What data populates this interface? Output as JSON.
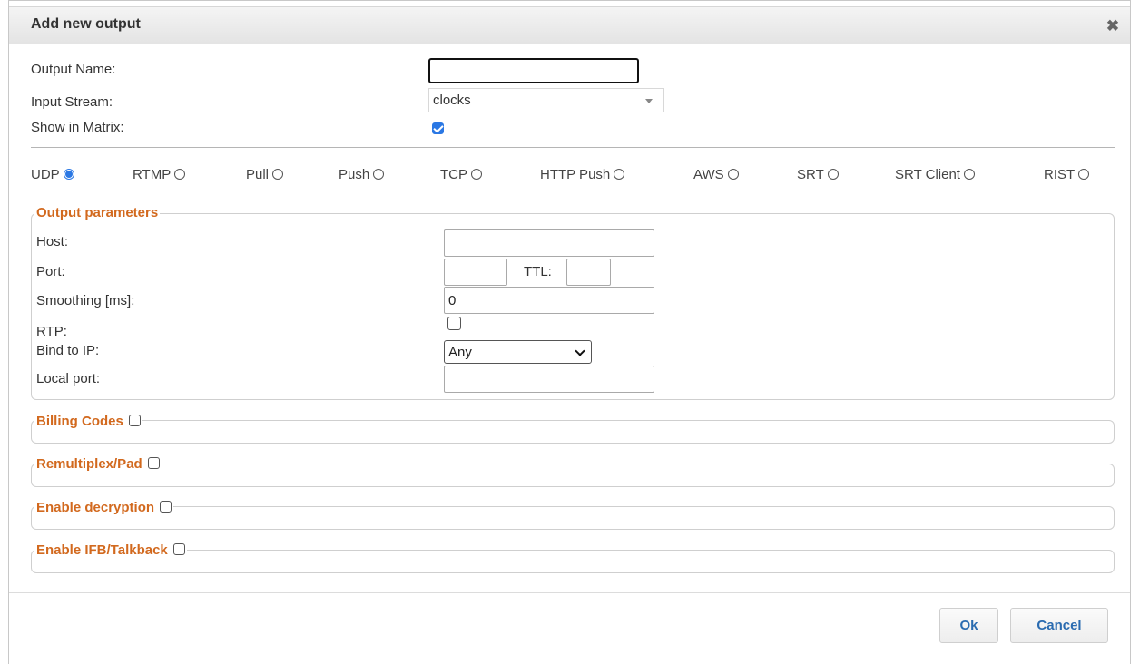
{
  "dialog": {
    "title": "Add new output"
  },
  "general": {
    "output_name_label": "Output Name:",
    "output_name_value": "",
    "input_stream_label": "Input Stream:",
    "input_stream_value": "clocks",
    "show_in_matrix_label": "Show in Matrix:",
    "show_in_matrix_checked": true
  },
  "protocols": [
    {
      "label": "UDP",
      "selected": true
    },
    {
      "label": "RTMP",
      "selected": false
    },
    {
      "label": "Pull",
      "selected": false
    },
    {
      "label": "Push",
      "selected": false
    },
    {
      "label": "TCP",
      "selected": false
    },
    {
      "label": "HTTP Push",
      "selected": false
    },
    {
      "label": "AWS",
      "selected": false
    },
    {
      "label": "SRT",
      "selected": false
    },
    {
      "label": "SRT Client",
      "selected": false
    },
    {
      "label": "RIST",
      "selected": false
    }
  ],
  "output_parameters": {
    "legend": "Output parameters",
    "host_label": "Host:",
    "host_value": "",
    "port_label": "Port:",
    "port_value": "",
    "ttl_label": "TTL:",
    "ttl_value": "",
    "smoothing_label": "Smoothing [ms]:",
    "smoothing_value": "0",
    "rtp_label": "RTP:",
    "rtp_checked": false,
    "bind_label": "Bind to IP:",
    "bind_value": "Any",
    "local_port_label": "Local port:",
    "local_port_value": ""
  },
  "sections": [
    {
      "label": "Billing Codes",
      "checked": false
    },
    {
      "label": "Remultiplex/Pad",
      "checked": false
    },
    {
      "label": "Enable decryption",
      "checked": false
    },
    {
      "label": "Enable IFB/Talkback",
      "checked": false
    }
  ],
  "footer": {
    "ok_label": "Ok",
    "cancel_label": "Cancel"
  },
  "colors": {
    "accent": "#2b78e4",
    "legend": "#d2691e",
    "button_text": "#2a6bb0"
  }
}
